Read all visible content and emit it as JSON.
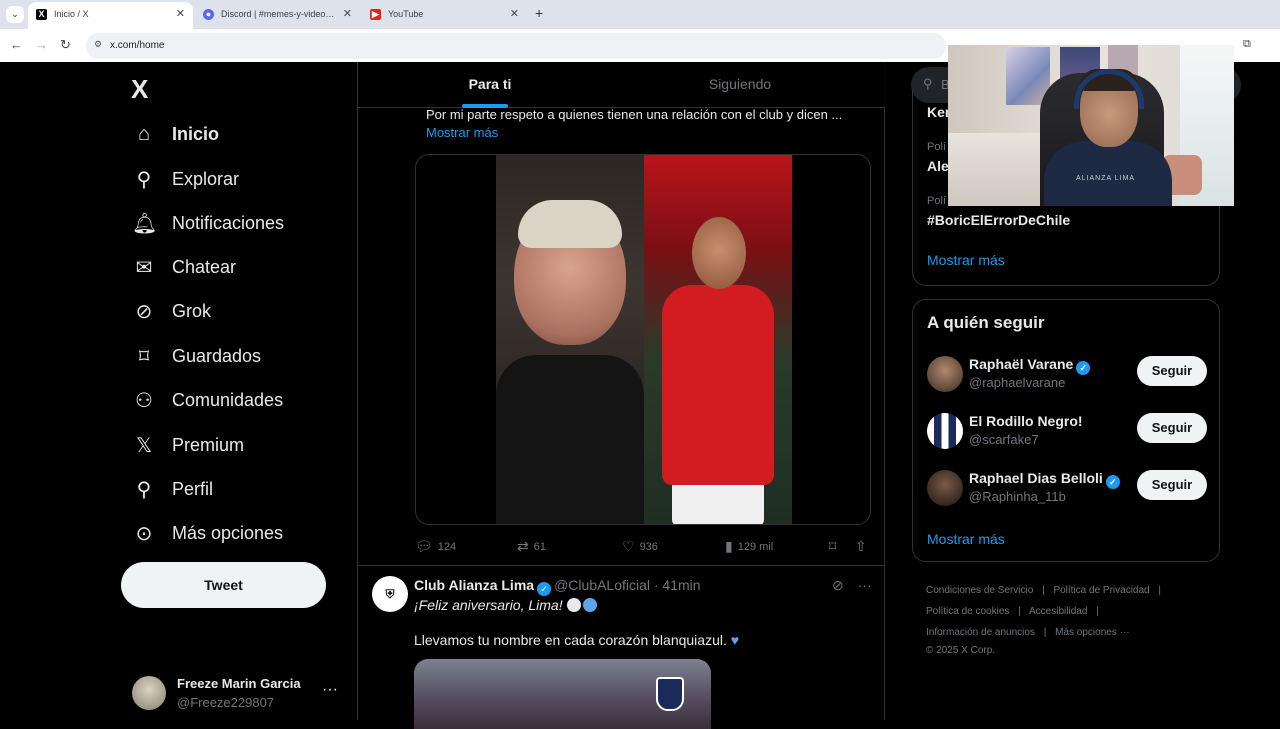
{
  "browser": {
    "tabs": [
      {
        "label": "Inicio / X",
        "active": true,
        "icon": "x-favicon"
      },
      {
        "label": "Discord | #memes-y-videos | El",
        "active": false,
        "icon": "discord-favicon"
      },
      {
        "label": "YouTube",
        "active": false,
        "icon": "youtube-favicon"
      }
    ],
    "new_tab": "+",
    "url": "x.com/home"
  },
  "sidebar": {
    "logo": "X",
    "items": [
      {
        "label": "Inicio",
        "icon": "home-icon",
        "glyph": "⌂"
      },
      {
        "label": "Explorar",
        "icon": "search-icon",
        "glyph": "⚲"
      },
      {
        "label": "Notificaciones",
        "icon": "bell-icon",
        "glyph": "🔔︎"
      },
      {
        "label": "Chatear",
        "icon": "mail-icon",
        "glyph": "✉"
      },
      {
        "label": "Grok",
        "icon": "grok-icon",
        "glyph": "⊘"
      },
      {
        "label": "Guardados",
        "icon": "bookmark-icon",
        "glyph": "⌑"
      },
      {
        "label": "Comunidades",
        "icon": "communities-icon",
        "glyph": "⚇"
      },
      {
        "label": "Premium",
        "icon": "x-premium-icon",
        "glyph": "𝕏"
      },
      {
        "label": "Perfil",
        "icon": "profile-icon",
        "glyph": "⚲"
      },
      {
        "label": "Más opciones",
        "icon": "more-circle-icon",
        "glyph": "⊙"
      }
    ],
    "tweet_button": "Tweet",
    "account": {
      "name": "Freeze Marin Garcia",
      "handle": "@Freeze229807",
      "menu": "···"
    }
  },
  "feed": {
    "tabs": [
      {
        "label": "Para ti",
        "active": true
      },
      {
        "label": "Siguiendo",
        "active": false
      }
    ],
    "tweet1": {
      "text": "Por mi parte respeto a quienes tienen una relación con el club y dicen ...",
      "show_more": "Mostrar más",
      "replies": "124",
      "retweets": "61",
      "likes": "936",
      "views": "129 mil"
    },
    "tweet2": {
      "author": "Club Alianza Lima",
      "handle": "@ClubALoficial",
      "time": "· 41min",
      "line1": "¡Feliz aniversario, Lima!",
      "line2": "Llevamos tu nombre en cada corazón blanquiazul."
    }
  },
  "right": {
    "search_placeholder": "B",
    "trends": [
      {
        "caption": "",
        "tag": "Ken"
      },
      {
        "caption": "Polí",
        "tag": "Ale"
      },
      {
        "caption": "Polí",
        "tag": "#BoricElErrorDeChile"
      }
    ],
    "trends_more": "Mostrar más",
    "follow_title": "A quién seguir",
    "follow": [
      {
        "name": "Raphaël Varane",
        "handle": "@raphaelvarane",
        "verified": true,
        "button": "Seguir"
      },
      {
        "name": "El Rodillo Negro!",
        "handle": "@scarfake7",
        "verified": false,
        "button": "Seguir"
      },
      {
        "name": "Raphael Dias Belloli",
        "handle": "@Raphinha_11b",
        "verified": true,
        "button": "Seguir"
      }
    ],
    "follow_more": "Mostrar más",
    "footer": {
      "l1a": "Condiciones de Servicio",
      "l1b": "Política de Privacidad",
      "l2a": "Política de cookies",
      "l2b": "Accesibilidad",
      "l3a": "Información de anuncios",
      "l3b": "Más opciones ···",
      "copy": "© 2025 X Corp.",
      "sep": "|"
    }
  },
  "webcam": {
    "shirt_text": "ALIANZA LIMA"
  },
  "colors": {
    "accent": "#1d9bf0",
    "bg": "#000000",
    "border": "#2f3336",
    "muted": "#71767b"
  }
}
